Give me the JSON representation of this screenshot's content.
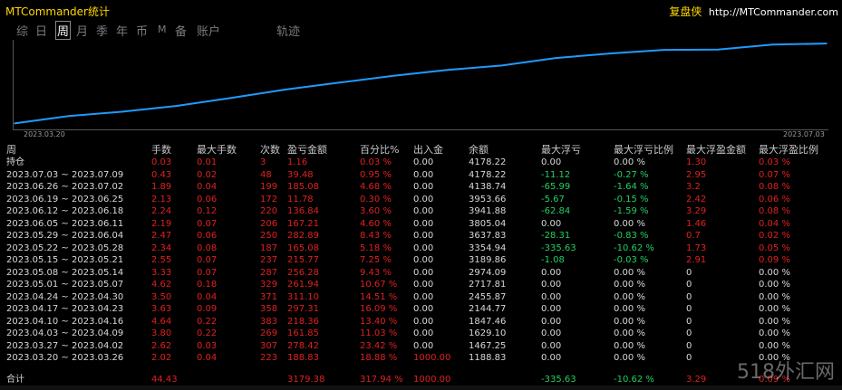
{
  "window": {
    "title": "MTCommander统计",
    "brand_cn": "复盘侠",
    "brand_url": "http://MTCommander.com"
  },
  "tabs": [
    "综",
    "日",
    "周",
    "月",
    "季",
    "年",
    "币",
    "M",
    "备",
    "账户",
    "轨迹"
  ],
  "active_tab": "周",
  "chart": {
    "start_label": "2023.03.20",
    "end_label": "2023.07.03",
    "line_color": "#1e9bff"
  },
  "chart_data": {
    "type": "line",
    "x": [
      "2023.03.20",
      "2023.03.27",
      "2023.04.03",
      "2023.04.10",
      "2023.04.17",
      "2023.04.24",
      "2023.05.01",
      "2023.05.08",
      "2023.05.15",
      "2023.05.22",
      "2023.05.29",
      "2023.06.05",
      "2023.06.12",
      "2023.06.19",
      "2023.06.26",
      "2023.07.03"
    ],
    "y": [
      188.83,
      467.25,
      629.1,
      847.46,
      1144.77,
      1455.87,
      1717.81,
      1974.09,
      2189.86,
      2354.92,
      2637.83,
      2805.04,
      2941.88,
      2953.66,
      3138.74,
      3178.22
    ]
  },
  "table": {
    "headers": [
      "周",
      "手数",
      "最大手数",
      "次数",
      "盈亏金额",
      "百分比%",
      "出入金",
      "余额",
      "最大浮亏",
      "最大浮亏比例",
      "最大浮盈金额",
      "最大浮盈比例"
    ],
    "rows": [
      {
        "period": "持仓",
        "lots": "0.03",
        "maxlots": "0.01",
        "count": "3",
        "pnl": "1.16",
        "pct": "0.03 %",
        "io": "0.00",
        "bal": "4178.22",
        "mdd": "0.00",
        "mddp": "0.00 %",
        "mfe": "1.30",
        "mfep": "0.03 %"
      },
      {
        "period": "2023.07.03 ~ 2023.07.09",
        "lots": "0.43",
        "maxlots": "0.02",
        "count": "48",
        "pnl": "39.48",
        "pct": "0.95 %",
        "io": "0.00",
        "bal": "4178.22",
        "mdd": "-11.12",
        "mddp": "-0.27 %",
        "mfe": "2.95",
        "mfep": "0.07 %"
      },
      {
        "period": "2023.06.26 ~ 2023.07.02",
        "lots": "1.89",
        "maxlots": "0.04",
        "count": "199",
        "pnl": "185.08",
        "pct": "4.68 %",
        "io": "0.00",
        "bal": "4138.74",
        "mdd": "-65.99",
        "mddp": "-1.64 %",
        "mfe": "3.2",
        "mfep": "0.08 %"
      },
      {
        "period": "2023.06.19 ~ 2023.06.25",
        "lots": "2.13",
        "maxlots": "0.06",
        "count": "172",
        "pnl": "11.78",
        "pct": "0.30 %",
        "io": "0.00",
        "bal": "3953.66",
        "mdd": "-5.67",
        "mddp": "-0.15 %",
        "mfe": "2.42",
        "mfep": "0.06 %"
      },
      {
        "period": "2023.06.12 ~ 2023.06.18",
        "lots": "2.24",
        "maxlots": "0.12",
        "count": "220",
        "pnl": "136.84",
        "pct": "3.60 %",
        "io": "0.00",
        "bal": "3941.88",
        "mdd": "-62.84",
        "mddp": "-1.59 %",
        "mfe": "3.29",
        "mfep": "0.08 %"
      },
      {
        "period": "2023.06.05 ~ 2023.06.11",
        "lots": "2.19",
        "maxlots": "0.07",
        "count": "206",
        "pnl": "167.21",
        "pct": "4.60 %",
        "io": "0.00",
        "bal": "3805.04",
        "mdd": "0.00",
        "mddp": "0.00 %",
        "mfe": "1.46",
        "mfep": "0.04 %"
      },
      {
        "period": "2023.05.29 ~ 2023.06.04",
        "lots": "2.47",
        "maxlots": "0.06",
        "count": "250",
        "pnl": "282.89",
        "pct": "8.43 %",
        "io": "0.00",
        "bal": "3637.83",
        "mdd": "-28.31",
        "mddp": "-0.83 %",
        "mfe": "0.7",
        "mfep": "0.02 %"
      },
      {
        "period": "2023.05.22 ~ 2023.05.28",
        "lots": "2.34",
        "maxlots": "0.08",
        "count": "187",
        "pnl": "165.08",
        "pct": "5.18 %",
        "io": "0.00",
        "bal": "3354.94",
        "mdd": "-335.63",
        "mddp": "-10.62 %",
        "mfe": "1.73",
        "mfep": "0.05 %"
      },
      {
        "period": "2023.05.15 ~ 2023.05.21",
        "lots": "2.55",
        "maxlots": "0.07",
        "count": "237",
        "pnl": "215.77",
        "pct": "7.25 %",
        "io": "0.00",
        "bal": "3189.86",
        "mdd": "-1.08",
        "mddp": "-0.03 %",
        "mfe": "2.91",
        "mfep": "0.09 %"
      },
      {
        "period": "2023.05.08 ~ 2023.05.14",
        "lots": "3.33",
        "maxlots": "0.07",
        "count": "287",
        "pnl": "256.28",
        "pct": "9.43 %",
        "io": "0.00",
        "bal": "2974.09",
        "mdd": "0.00",
        "mddp": "0.00 %",
        "mfe": "0",
        "mfep": "0.00 %"
      },
      {
        "period": "2023.05.01 ~ 2023.05.07",
        "lots": "4.62",
        "maxlots": "0.18",
        "count": "329",
        "pnl": "261.94",
        "pct": "10.67 %",
        "io": "0.00",
        "bal": "2717.81",
        "mdd": "0.00",
        "mddp": "0.00 %",
        "mfe": "0",
        "mfep": "0.00 %"
      },
      {
        "period": "2023.04.24 ~ 2023.04.30",
        "lots": "3.50",
        "maxlots": "0.04",
        "count": "371",
        "pnl": "311.10",
        "pct": "14.51 %",
        "io": "0.00",
        "bal": "2455.87",
        "mdd": "0.00",
        "mddp": "0.00 %",
        "mfe": "0",
        "mfep": "0.00 %"
      },
      {
        "period": "2023.04.17 ~ 2023.04.23",
        "lots": "3.63",
        "maxlots": "0.09",
        "count": "358",
        "pnl": "297.31",
        "pct": "16.09 %",
        "io": "0.00",
        "bal": "2144.77",
        "mdd": "0.00",
        "mddp": "0.00 %",
        "mfe": "0",
        "mfep": "0.00 %"
      },
      {
        "period": "2023.04.10 ~ 2023.04.16",
        "lots": "4.64",
        "maxlots": "0.22",
        "count": "383",
        "pnl": "218.36",
        "pct": "13.40 %",
        "io": "0.00",
        "bal": "1847.46",
        "mdd": "0.00",
        "mddp": "0.00 %",
        "mfe": "0",
        "mfep": "0.00 %"
      },
      {
        "period": "2023.04.03 ~ 2023.04.09",
        "lots": "3.80",
        "maxlots": "0.22",
        "count": "269",
        "pnl": "161.85",
        "pct": "11.03 %",
        "io": "0.00",
        "bal": "1629.10",
        "mdd": "0.00",
        "mddp": "0.00 %",
        "mfe": "0",
        "mfep": "0.00 %"
      },
      {
        "period": "2023.03.27 ~ 2023.04.02",
        "lots": "2.62",
        "maxlots": "0.03",
        "count": "307",
        "pnl": "278.42",
        "pct": "23.42 %",
        "io": "0.00",
        "bal": "1467.25",
        "mdd": "0.00",
        "mddp": "0.00 %",
        "mfe": "0",
        "mfep": "0.00 %"
      },
      {
        "period": "2023.03.20 ~ 2023.03.26",
        "lots": "2.02",
        "maxlots": "0.04",
        "count": "223",
        "pnl": "188.83",
        "pct": "18.88 %",
        "io": "1000.00",
        "bal": "1188.83",
        "mdd": "0.00",
        "mddp": "0.00 %",
        "mfe": "0",
        "mfep": "0.00 %"
      }
    ],
    "total": {
      "period": "合计",
      "lots": "44.43",
      "maxlots": "",
      "count": "",
      "pnl": "3179.38",
      "pct": "317.94 %",
      "io": "1000.00",
      "bal": "",
      "mdd": "-335.63",
      "mddp": "-10.62 %",
      "mfe": "3.29",
      "mfep": "0.09 %"
    }
  },
  "watermark": "518外汇网"
}
